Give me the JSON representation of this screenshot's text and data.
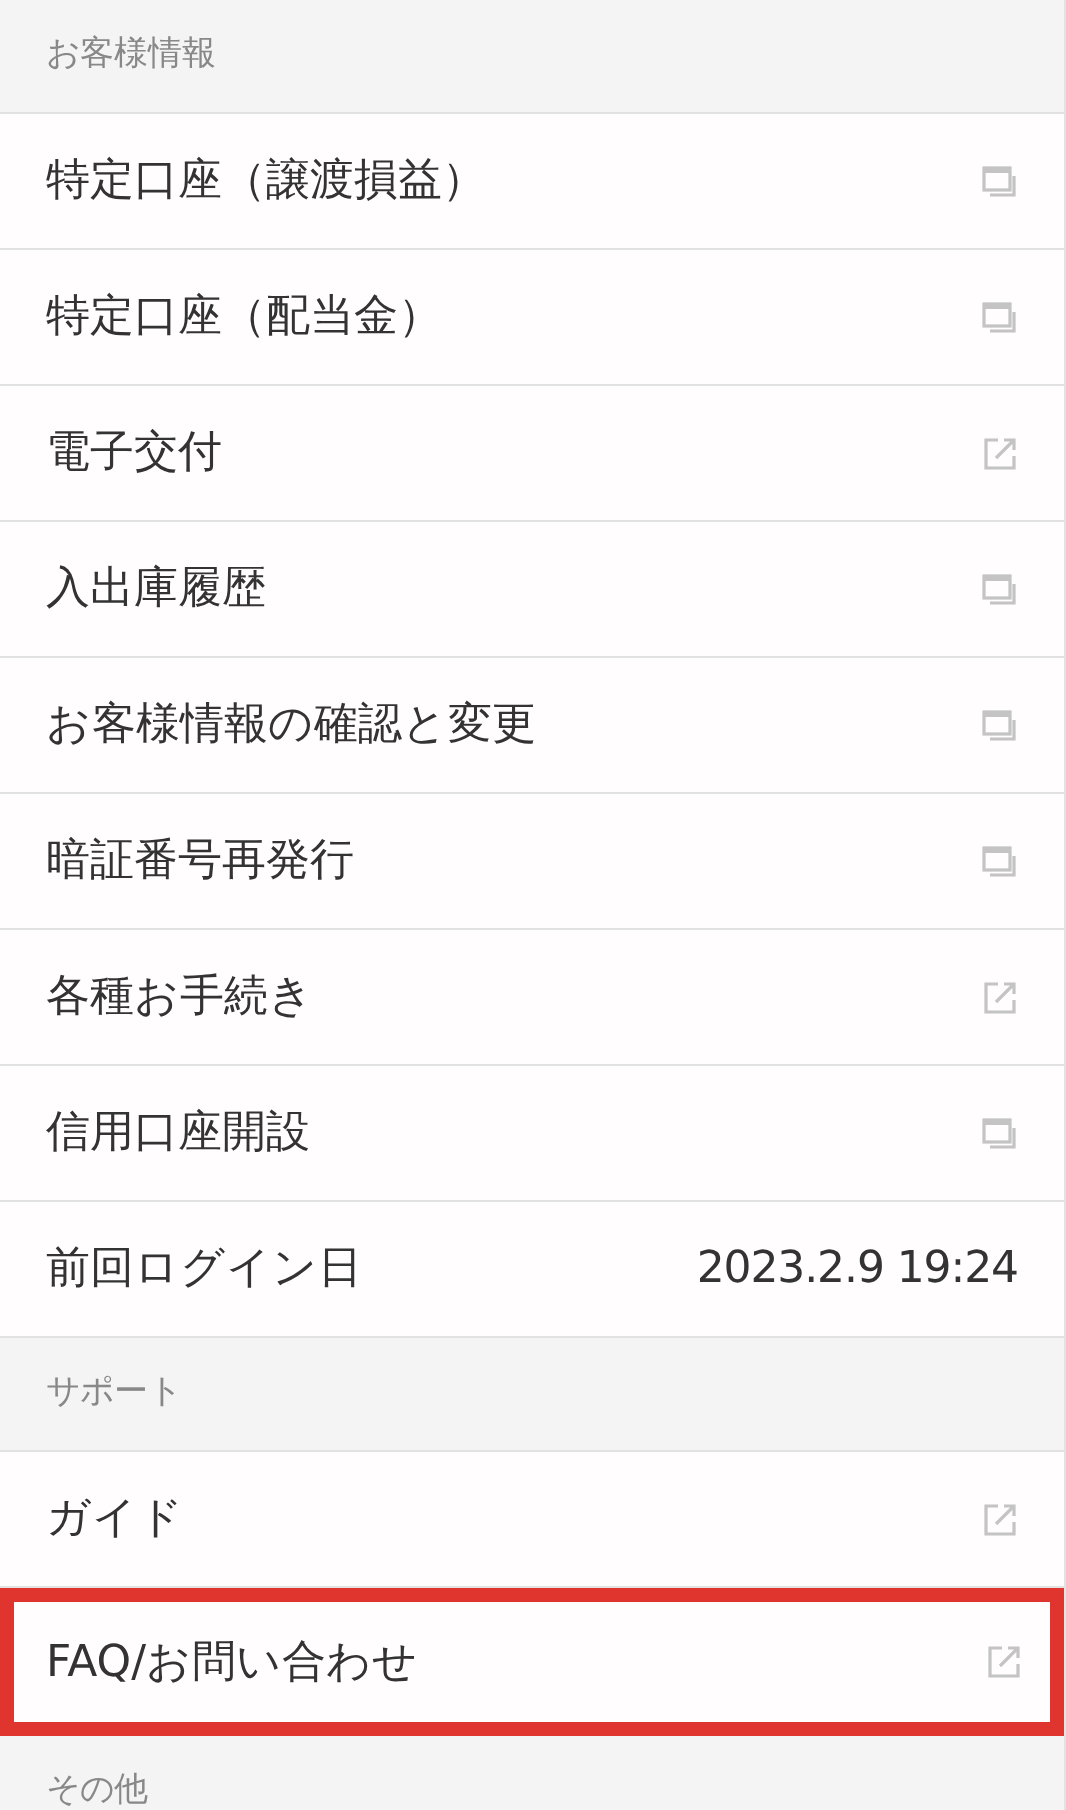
{
  "sections": [
    {
      "title": "お客様情報",
      "items": [
        {
          "label": "特定口座（譲渡損益）",
          "kind": "window",
          "highlighted": false
        },
        {
          "label": "特定口座（配当金）",
          "kind": "window",
          "highlighted": false
        },
        {
          "label": "電子交付",
          "kind": "external",
          "highlighted": false
        },
        {
          "label": "入出庫履歴",
          "kind": "window",
          "highlighted": false
        },
        {
          "label": "お客様情報の確認と変更",
          "kind": "window",
          "highlighted": false
        },
        {
          "label": "暗証番号再発行",
          "kind": "window",
          "highlighted": false
        },
        {
          "label": "各種お手続き",
          "kind": "external",
          "highlighted": false
        },
        {
          "label": "信用口座開設",
          "kind": "window",
          "highlighted": false
        },
        {
          "label": "前回ログイン日",
          "kind": "value",
          "value": "2023.2.9 19:24",
          "highlighted": false
        }
      ]
    },
    {
      "title": "サポート",
      "items": [
        {
          "label": "ガイド",
          "kind": "external",
          "highlighted": false
        },
        {
          "label": "FAQ/お問い合わせ",
          "kind": "external",
          "highlighted": true
        }
      ]
    },
    {
      "title": "その他"
    }
  ]
}
